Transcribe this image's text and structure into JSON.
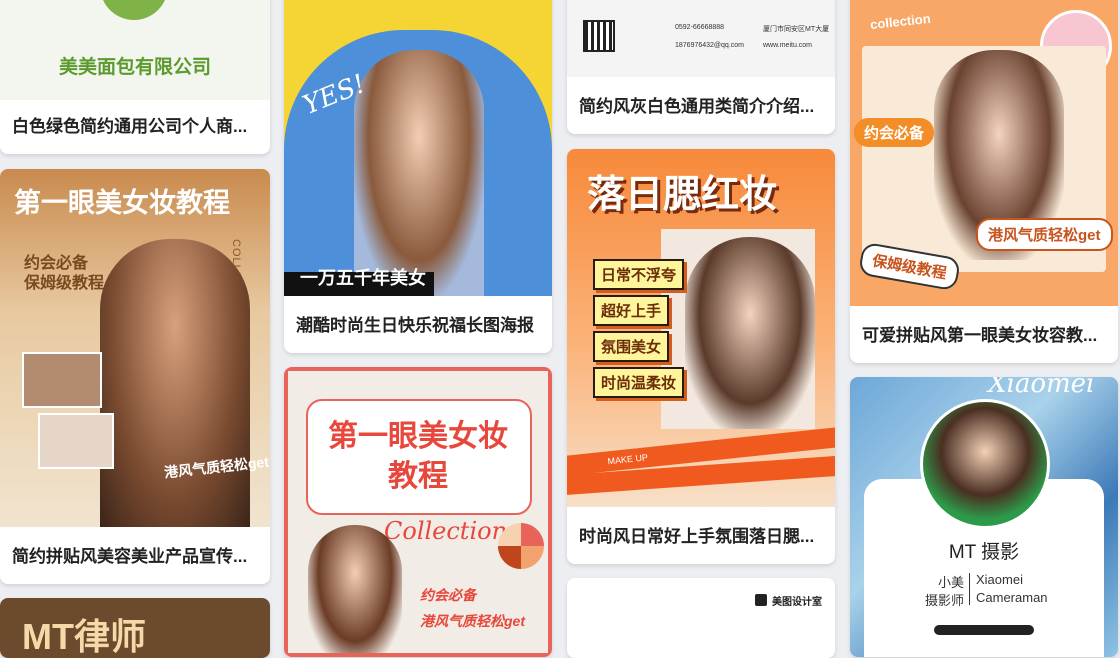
{
  "colors": {
    "accent_orange": "#f07a26",
    "accent_red": "#e84a3d",
    "brand_green": "#5c9a2e",
    "page_bg": "#eceef1"
  },
  "cards": [
    {
      "caption": "白色绿色简约通用公司个人商...",
      "thumb": {
        "company": "美美面包有限公司"
      }
    },
    {
      "caption": "简约拼贴风美容美业产品宣传...",
      "thumb": {
        "title": "第一眼美女妆教程",
        "sub1": "约会必备",
        "sub2": "保姆级教程",
        "side": "COLLECTION",
        "foot": "港风气质轻松get"
      }
    },
    {
      "caption": "",
      "thumb": {
        "title": "MT律师"
      }
    },
    {
      "caption": "潮酷时尚生日快乐祝福长图海报",
      "thumb": {
        "yes": "YES!",
        "line": "一万五千年美女"
      }
    },
    {
      "caption": "",
      "thumb": {
        "title1": "第一眼美女妆",
        "title2": "教程",
        "collection": "Collection",
        "sub1": "约会必备",
        "sub2": "港风气质轻松get"
      }
    },
    {
      "caption": "简约风灰白色通用类简介介绍...",
      "thumb": {
        "phone": "0592-66668888",
        "email": "1876976432@qq.com",
        "addr": "厦门市同安区MT大厦",
        "web": "www.meitu.com"
      }
    },
    {
      "caption": "时尚风日常好上手氛围落日腮...",
      "thumb": {
        "title": "落日腮红妆",
        "tags": [
          "日常不浮夸",
          "超好上手",
          "氛围美女",
          "时尚温柔妆"
        ],
        "tape": "MAKE UP"
      }
    },
    {
      "caption": "",
      "thumb": {
        "brand": "美图设计室"
      }
    },
    {
      "caption": "可爱拼贴风第一眼美女妆容教...",
      "thumb": {
        "collection": "collection",
        "badge1": "约会必备",
        "badge2": "港风气质轻松get",
        "badge3": "保姆级教程"
      }
    },
    {
      "caption": "",
      "thumb": {
        "script": "Xiaomei",
        "name": "MT 摄影",
        "l1": "小美",
        "r1": "Xiaomei",
        "l2": "摄影师",
        "r2": "Cameraman"
      }
    }
  ]
}
